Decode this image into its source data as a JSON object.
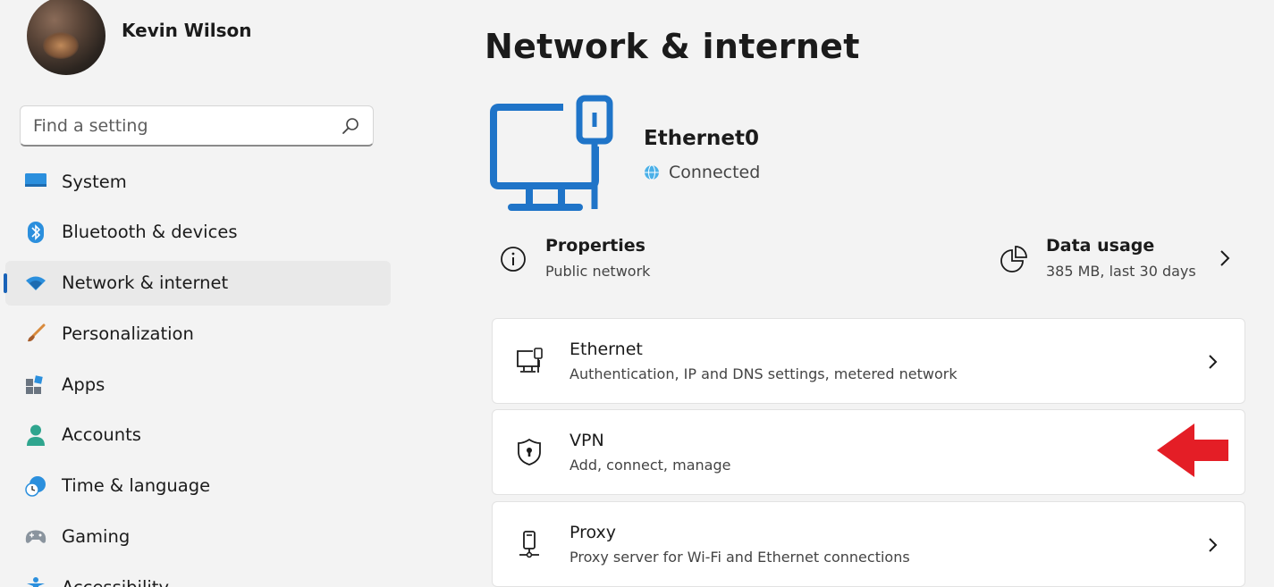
{
  "colors": {
    "accent": "#1a63b8",
    "hero_icon": "#1f74c8",
    "arrow": "#e41e26"
  },
  "user": {
    "name": "Kevin Wilson"
  },
  "search": {
    "placeholder": "Find a setting"
  },
  "sidebar": {
    "items": [
      {
        "label": "System",
        "icon": "monitor-icon"
      },
      {
        "label": "Bluetooth & devices",
        "icon": "bluetooth-icon"
      },
      {
        "label": "Network & internet",
        "icon": "wifi-icon",
        "active": true
      },
      {
        "label": "Personalization",
        "icon": "brush-icon"
      },
      {
        "label": "Apps",
        "icon": "apps-icon"
      },
      {
        "label": "Accounts",
        "icon": "person-icon"
      },
      {
        "label": "Time & language",
        "icon": "clock-globe-icon"
      },
      {
        "label": "Gaming",
        "icon": "gamepad-icon"
      },
      {
        "label": "Accessibility",
        "icon": "accessibility-icon"
      }
    ]
  },
  "main": {
    "title": "Network & internet",
    "connection": {
      "name": "Ethernet0",
      "status": "Connected"
    },
    "properties": {
      "title": "Properties",
      "subtitle": "Public network"
    },
    "data_usage": {
      "title": "Data usage",
      "subtitle": "385 MB, last 30 days"
    },
    "cards": [
      {
        "title": "Ethernet",
        "subtitle": "Authentication, IP and DNS settings, metered network",
        "icon": "ethernet-icon"
      },
      {
        "title": "VPN",
        "subtitle": "Add, connect, manage",
        "icon": "shield-icon"
      },
      {
        "title": "Proxy",
        "subtitle": "Proxy server for Wi-Fi and Ethernet connections",
        "icon": "proxy-icon"
      }
    ]
  }
}
